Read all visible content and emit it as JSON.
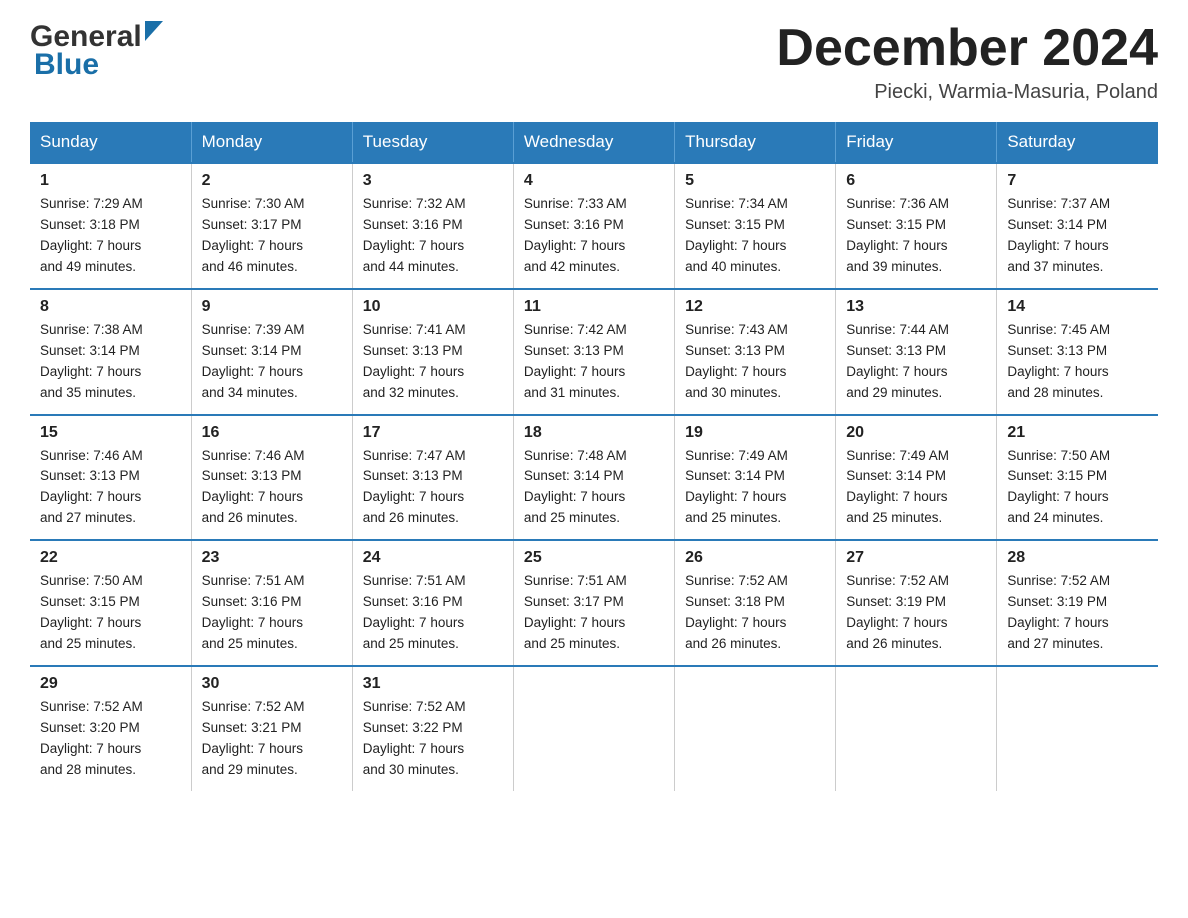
{
  "header": {
    "logo_general": "General",
    "logo_blue": "Blue",
    "month_year": "December 2024",
    "location": "Piecki, Warmia-Masuria, Poland"
  },
  "calendar": {
    "days_of_week": [
      "Sunday",
      "Monday",
      "Tuesday",
      "Wednesday",
      "Thursday",
      "Friday",
      "Saturday"
    ],
    "weeks": [
      [
        {
          "day": "1",
          "sunrise": "7:29 AM",
          "sunset": "3:18 PM",
          "daylight": "7 hours and 49 minutes."
        },
        {
          "day": "2",
          "sunrise": "7:30 AM",
          "sunset": "3:17 PM",
          "daylight": "7 hours and 46 minutes."
        },
        {
          "day": "3",
          "sunrise": "7:32 AM",
          "sunset": "3:16 PM",
          "daylight": "7 hours and 44 minutes."
        },
        {
          "day": "4",
          "sunrise": "7:33 AM",
          "sunset": "3:16 PM",
          "daylight": "7 hours and 42 minutes."
        },
        {
          "day": "5",
          "sunrise": "7:34 AM",
          "sunset": "3:15 PM",
          "daylight": "7 hours and 40 minutes."
        },
        {
          "day": "6",
          "sunrise": "7:36 AM",
          "sunset": "3:15 PM",
          "daylight": "7 hours and 39 minutes."
        },
        {
          "day": "7",
          "sunrise": "7:37 AM",
          "sunset": "3:14 PM",
          "daylight": "7 hours and 37 minutes."
        }
      ],
      [
        {
          "day": "8",
          "sunrise": "7:38 AM",
          "sunset": "3:14 PM",
          "daylight": "7 hours and 35 minutes."
        },
        {
          "day": "9",
          "sunrise": "7:39 AM",
          "sunset": "3:14 PM",
          "daylight": "7 hours and 34 minutes."
        },
        {
          "day": "10",
          "sunrise": "7:41 AM",
          "sunset": "3:13 PM",
          "daylight": "7 hours and 32 minutes."
        },
        {
          "day": "11",
          "sunrise": "7:42 AM",
          "sunset": "3:13 PM",
          "daylight": "7 hours and 31 minutes."
        },
        {
          "day": "12",
          "sunrise": "7:43 AM",
          "sunset": "3:13 PM",
          "daylight": "7 hours and 30 minutes."
        },
        {
          "day": "13",
          "sunrise": "7:44 AM",
          "sunset": "3:13 PM",
          "daylight": "7 hours and 29 minutes."
        },
        {
          "day": "14",
          "sunrise": "7:45 AM",
          "sunset": "3:13 PM",
          "daylight": "7 hours and 28 minutes."
        }
      ],
      [
        {
          "day": "15",
          "sunrise": "7:46 AM",
          "sunset": "3:13 PM",
          "daylight": "7 hours and 27 minutes."
        },
        {
          "day": "16",
          "sunrise": "7:46 AM",
          "sunset": "3:13 PM",
          "daylight": "7 hours and 26 minutes."
        },
        {
          "day": "17",
          "sunrise": "7:47 AM",
          "sunset": "3:13 PM",
          "daylight": "7 hours and 26 minutes."
        },
        {
          "day": "18",
          "sunrise": "7:48 AM",
          "sunset": "3:14 PM",
          "daylight": "7 hours and 25 minutes."
        },
        {
          "day": "19",
          "sunrise": "7:49 AM",
          "sunset": "3:14 PM",
          "daylight": "7 hours and 25 minutes."
        },
        {
          "day": "20",
          "sunrise": "7:49 AM",
          "sunset": "3:14 PM",
          "daylight": "7 hours and 25 minutes."
        },
        {
          "day": "21",
          "sunrise": "7:50 AM",
          "sunset": "3:15 PM",
          "daylight": "7 hours and 24 minutes."
        }
      ],
      [
        {
          "day": "22",
          "sunrise": "7:50 AM",
          "sunset": "3:15 PM",
          "daylight": "7 hours and 25 minutes."
        },
        {
          "day": "23",
          "sunrise": "7:51 AM",
          "sunset": "3:16 PM",
          "daylight": "7 hours and 25 minutes."
        },
        {
          "day": "24",
          "sunrise": "7:51 AM",
          "sunset": "3:16 PM",
          "daylight": "7 hours and 25 minutes."
        },
        {
          "day": "25",
          "sunrise": "7:51 AM",
          "sunset": "3:17 PM",
          "daylight": "7 hours and 25 minutes."
        },
        {
          "day": "26",
          "sunrise": "7:52 AM",
          "sunset": "3:18 PM",
          "daylight": "7 hours and 26 minutes."
        },
        {
          "day": "27",
          "sunrise": "7:52 AM",
          "sunset": "3:19 PM",
          "daylight": "7 hours and 26 minutes."
        },
        {
          "day": "28",
          "sunrise": "7:52 AM",
          "sunset": "3:19 PM",
          "daylight": "7 hours and 27 minutes."
        }
      ],
      [
        {
          "day": "29",
          "sunrise": "7:52 AM",
          "sunset": "3:20 PM",
          "daylight": "7 hours and 28 minutes."
        },
        {
          "day": "30",
          "sunrise": "7:52 AM",
          "sunset": "3:21 PM",
          "daylight": "7 hours and 29 minutes."
        },
        {
          "day": "31",
          "sunrise": "7:52 AM",
          "sunset": "3:22 PM",
          "daylight": "7 hours and 30 minutes."
        },
        null,
        null,
        null,
        null
      ]
    ],
    "labels": {
      "sunrise": "Sunrise:",
      "sunset": "Sunset:",
      "daylight": "Daylight:"
    }
  }
}
